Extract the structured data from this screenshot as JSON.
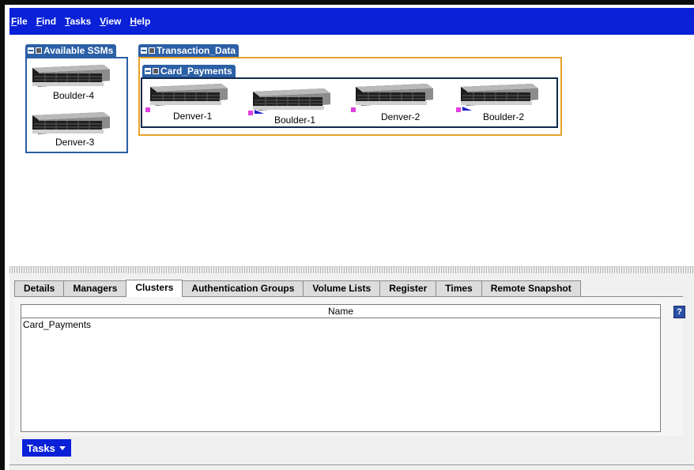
{
  "menu": [
    {
      "label": "File",
      "mnemonic": "F",
      "rest": "ile"
    },
    {
      "label": "Find",
      "mnemonic": "F",
      "rest": "ind"
    },
    {
      "label": "Tasks",
      "mnemonic": "T",
      "rest": "asks"
    },
    {
      "label": "View",
      "mnemonic": "V",
      "rest": "iew"
    },
    {
      "label": "Help",
      "mnemonic": "H",
      "rest": "elp"
    }
  ],
  "map": {
    "available": {
      "title": "Available SSMs",
      "nodes": [
        {
          "label": "Boulder-4",
          "icon": "storage-server-icon"
        },
        {
          "label": "Denver-3",
          "icon": "storage-server-icon"
        }
      ]
    },
    "management_group": {
      "title": "Transaction_Data",
      "cluster": {
        "title": "Card_Payments",
        "nodes": [
          {
            "label": "Denver-1",
            "icon": "storage-server-icon",
            "marker": "magenta"
          },
          {
            "label": "Boulder-1",
            "icon": "storage-server-icon",
            "marker": "magenta-blue"
          },
          {
            "label": "Denver-2",
            "icon": "storage-server-icon",
            "marker": "magenta"
          },
          {
            "label": "Boulder-2",
            "icon": "storage-server-icon",
            "marker": "magenta-blue"
          }
        ]
      }
    }
  },
  "tabs": [
    {
      "label": "Details",
      "active": false
    },
    {
      "label": "Managers",
      "active": false
    },
    {
      "label": "Clusters",
      "active": true
    },
    {
      "label": "Authentication Groups",
      "active": false
    },
    {
      "label": "Volume Lists",
      "active": false
    },
    {
      "label": "Register",
      "active": false
    },
    {
      "label": "Times",
      "active": false
    },
    {
      "label": "Remote Snapshot",
      "active": false
    }
  ],
  "clusters_table": {
    "columns": [
      "Name"
    ],
    "rows": [
      [
        "Card_Payments"
      ]
    ]
  },
  "help_label": "?",
  "tasks_button": {
    "label": "Tasks"
  },
  "colors": {
    "menubar": "#0a21d8",
    "group_header": "#2b5fa6",
    "management_border": "#e5a22a",
    "marker_magenta": "#e040e0",
    "marker_blue": "#2222cc"
  }
}
